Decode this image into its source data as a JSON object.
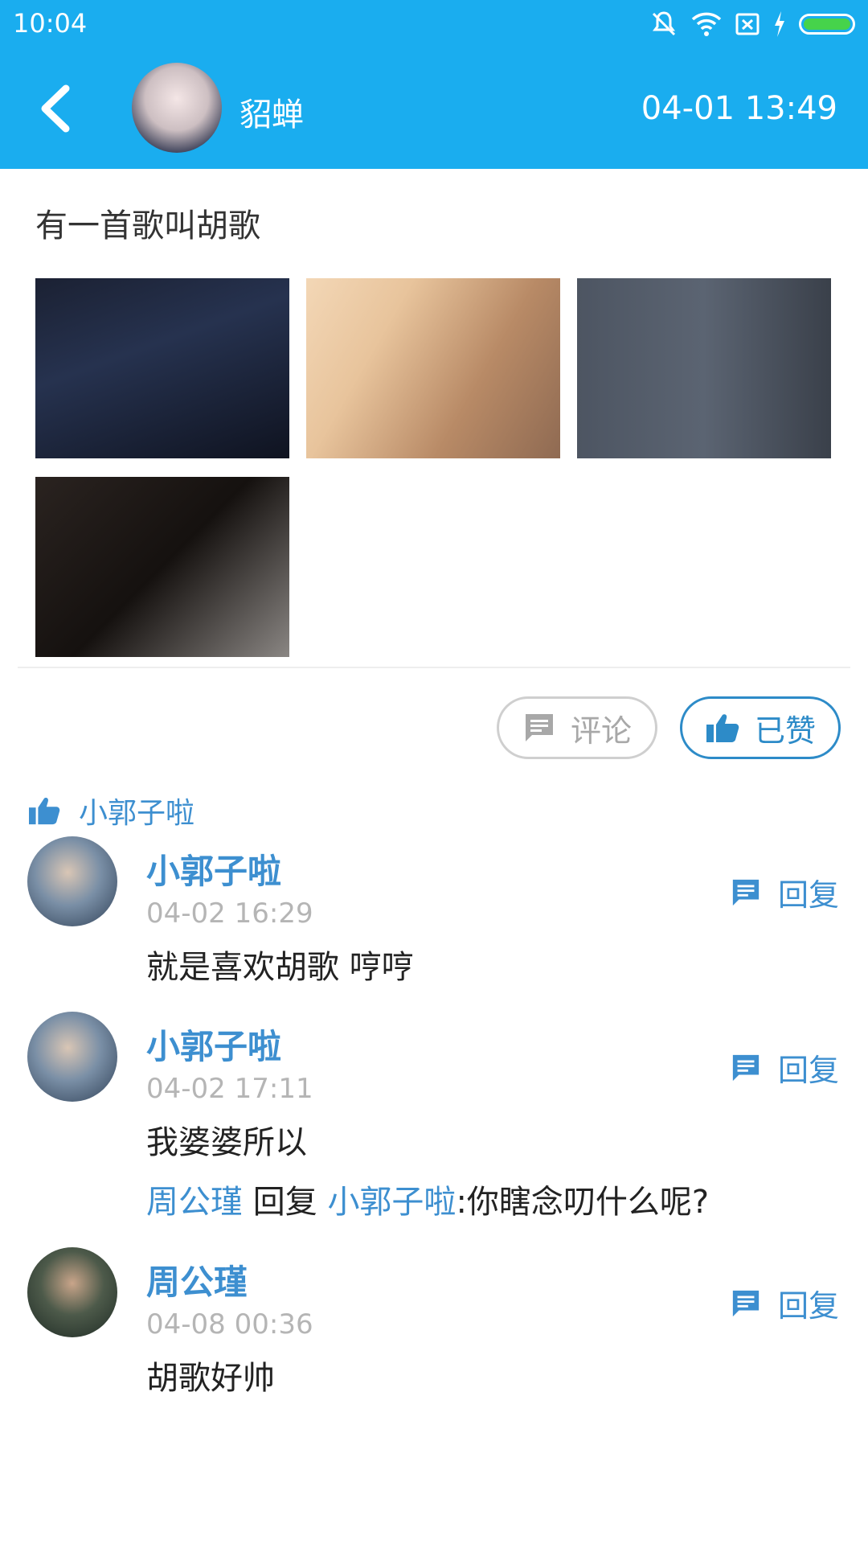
{
  "status_bar": {
    "time": "10:04"
  },
  "header": {
    "poster_name": "貂蝉",
    "post_datetime": "04-01 13:49"
  },
  "post": {
    "text": "有一首歌叫胡歌",
    "photo_count": 4
  },
  "actions": {
    "comment_label": "评论",
    "liked_label": "已赞"
  },
  "likes": {
    "users": [
      "小郭子啦"
    ]
  },
  "comments": [
    {
      "name": "小郭子啦",
      "time": "04-02 16:29",
      "text": "就是喜欢胡歌  哼哼",
      "reply_label": "回复"
    },
    {
      "name": "小郭子啦",
      "time": "04-02 17:11",
      "text": "我婆婆所以",
      "sub_reply": {
        "from": "周公瑾",
        "verb": "回复",
        "to": "小郭子啦",
        "text": ":你瞎念叨什么呢?"
      },
      "reply_label": "回复"
    },
    {
      "name": "周公瑾",
      "time": "04-08 00:36",
      "text": "胡歌好帅",
      "reply_label": "回复"
    }
  ],
  "colors": {
    "header": "#1AADEF",
    "accent": "#3D8FD0",
    "battery": "#46D34B"
  }
}
